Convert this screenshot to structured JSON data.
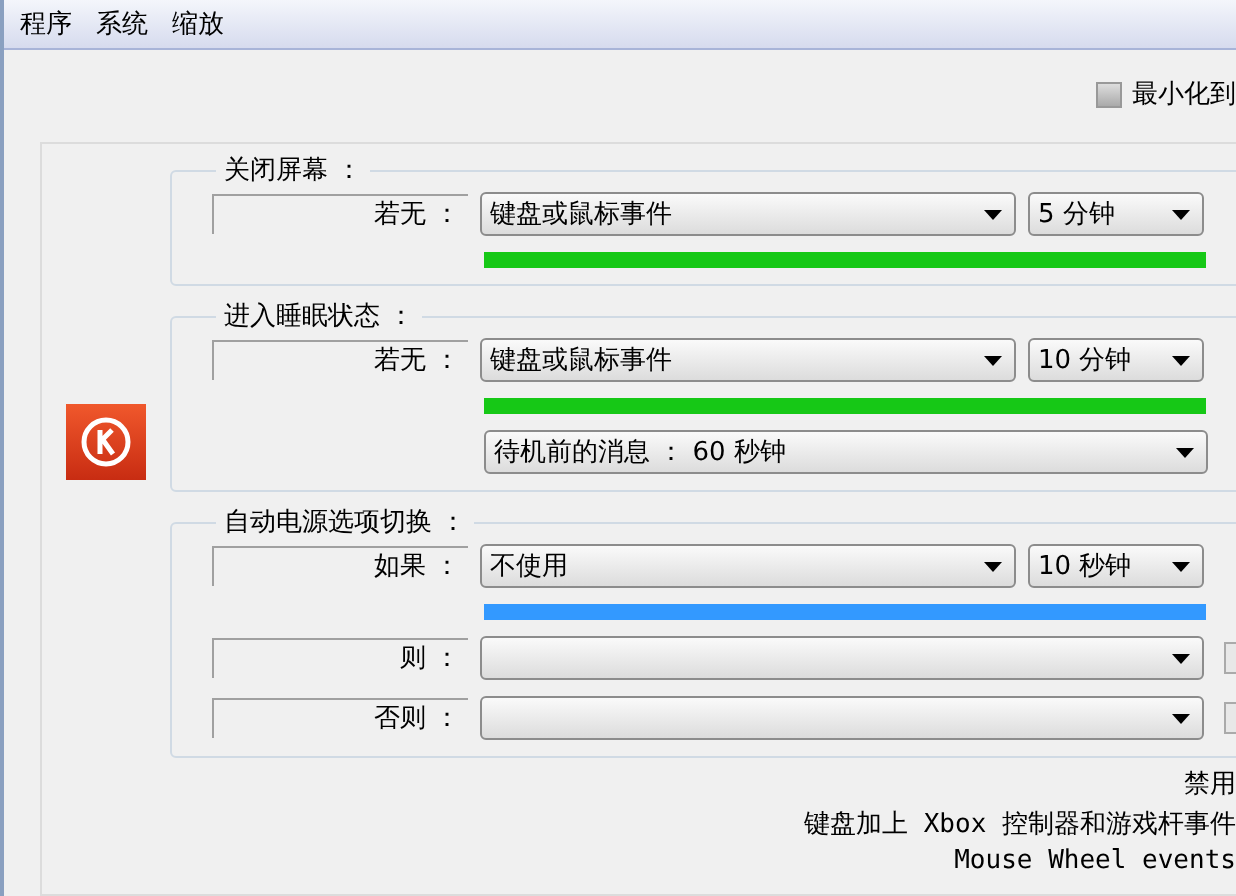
{
  "menu": [
    {
      "label": "程序"
    },
    {
      "label": "系统"
    },
    {
      "label": "缩放"
    }
  ],
  "minimize_checkbox": {
    "label": "最小化到",
    "checked": false
  },
  "groups": [
    {
      "title": "关闭屏幕 ：",
      "rows": [
        {
          "kind": "condition",
          "label": "若无 ：",
          "select": "键盘或鼠标事件",
          "time": "5 分钟"
        },
        {
          "kind": "bar",
          "level": 1,
          "color": "#16c816"
        }
      ]
    },
    {
      "title": "进入睡眠状态 ：",
      "rows": [
        {
          "kind": "condition",
          "label": "若无 ：",
          "select": "键盘或鼠标事件",
          "time": "10 分钟"
        },
        {
          "kind": "bar",
          "level": 1,
          "color": "#16c816"
        },
        {
          "kind": "select",
          "value": "待机前的消息 ： 60 秒钟"
        }
      ]
    },
    {
      "title": "自动电源选项切换 ：",
      "rows": [
        {
          "kind": "condition",
          "label": "如果 ：",
          "select": "不使用",
          "time": "10 秒钟"
        },
        {
          "kind": "bar",
          "level": 1,
          "color": "#3399ff"
        },
        {
          "kind": "blank",
          "label": "则 ：",
          "checked": false
        },
        {
          "kind": "blank",
          "label": "否则 ：",
          "checked": false
        }
      ]
    }
  ],
  "footer": [
    "禁用",
    "键盘加上 Xbox 控制器和游戏杆事件",
    "Mouse Wheel events"
  ]
}
